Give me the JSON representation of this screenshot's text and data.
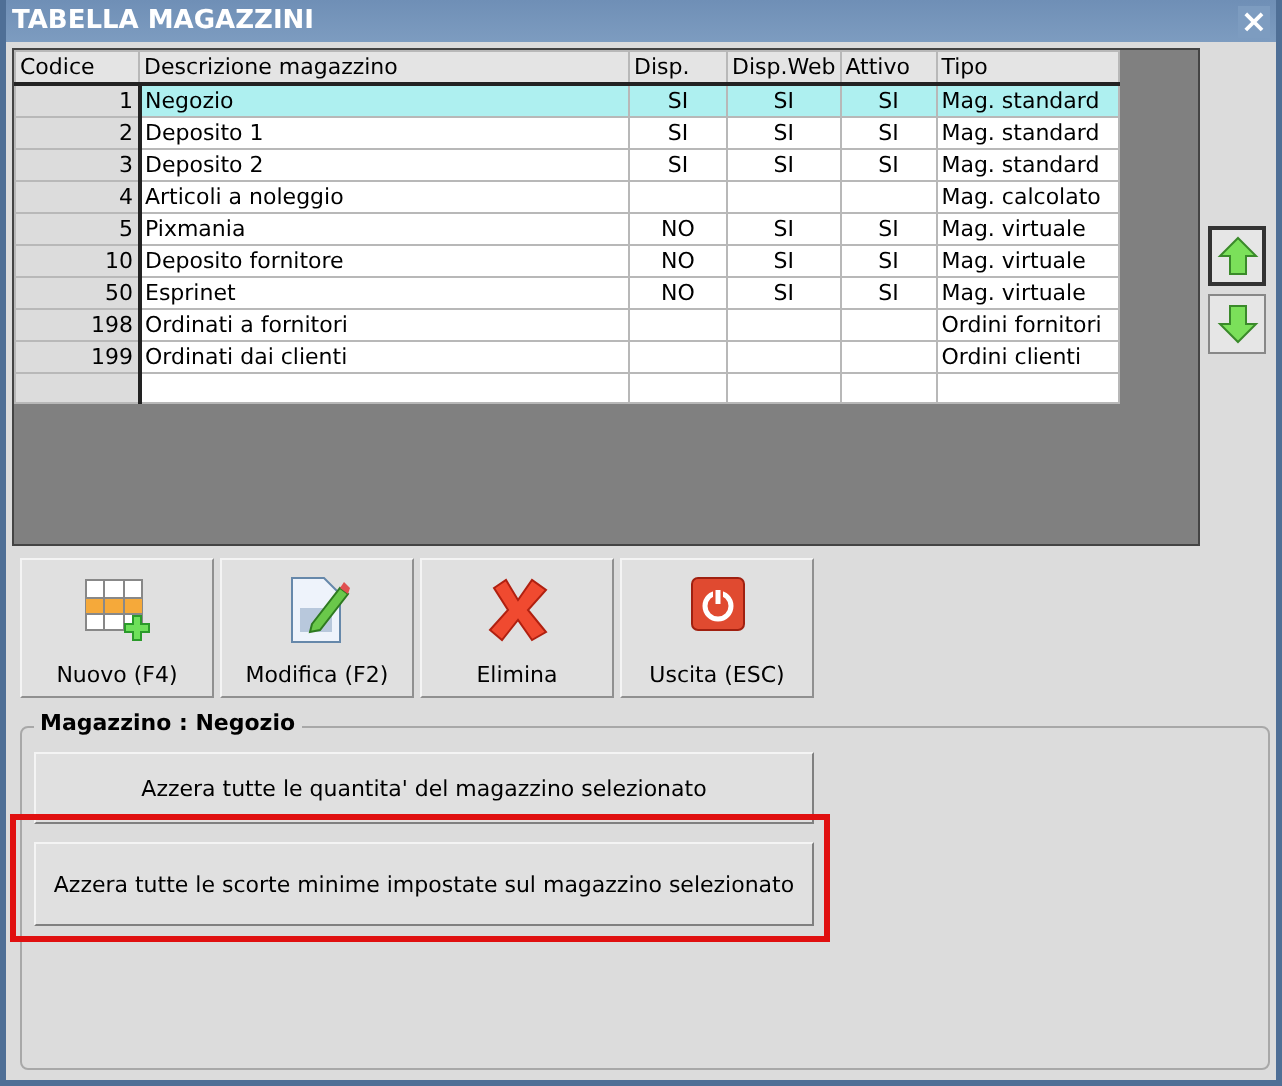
{
  "window": {
    "title": "TABELLA MAGAZZINI",
    "close": "×"
  },
  "table": {
    "columns": [
      "Codice",
      "Descrizione magazzino",
      "Disp.",
      "Disp.Web",
      "Attivo",
      "Tipo"
    ],
    "rows": [
      {
        "cells": [
          "1",
          "Negozio",
          "SI",
          "SI",
          "SI",
          "Mag. standard"
        ],
        "selected": true
      },
      {
        "cells": [
          "2",
          "Deposito 1",
          "SI",
          "SI",
          "SI",
          "Mag. standard"
        ],
        "selected": false
      },
      {
        "cells": [
          "3",
          "Deposito 2",
          "SI",
          "SI",
          "SI",
          "Mag. standard"
        ],
        "selected": false
      },
      {
        "cells": [
          "4",
          "Articoli a noleggio",
          "",
          "",
          "",
          "Mag. calcolato"
        ],
        "selected": false
      },
      {
        "cells": [
          "5",
          "Pixmania",
          "NO",
          "SI",
          "SI",
          "Mag. virtuale"
        ],
        "selected": false
      },
      {
        "cells": [
          "10",
          "Deposito fornitore",
          "NO",
          "SI",
          "SI",
          "Mag. virtuale"
        ],
        "selected": false
      },
      {
        "cells": [
          "50",
          "Esprinet",
          "NO",
          "SI",
          "SI",
          "Mag. virtuale"
        ],
        "selected": false
      },
      {
        "cells": [
          "198",
          "Ordinati a fornitori",
          "",
          "",
          "",
          "Ordini fornitori"
        ],
        "selected": false
      },
      {
        "cells": [
          "199",
          "Ordinati dai clienti",
          "",
          "",
          "",
          "Ordini clienti"
        ],
        "selected": false
      }
    ]
  },
  "move_buttons": [
    {
      "kind": "up",
      "focused": true
    },
    {
      "kind": "down",
      "focused": false
    }
  ],
  "toolbar": [
    {
      "kind": "new",
      "label": "Nuovo (F4)"
    },
    {
      "kind": "edit",
      "label": "Modifica (F2)"
    },
    {
      "kind": "delete",
      "label": "Elimina"
    },
    {
      "kind": "exit",
      "label": "Uscita (ESC)"
    }
  ],
  "group": {
    "legend": "Magazzino : Negozio",
    "actions": [
      {
        "label": "Azzera tutte le quantita' del magazzino selezionato",
        "highlighted": false
      },
      {
        "label": "Azzera tutte le scorte minime impostate sul magazzino selezionato",
        "highlighted": true
      }
    ]
  }
}
